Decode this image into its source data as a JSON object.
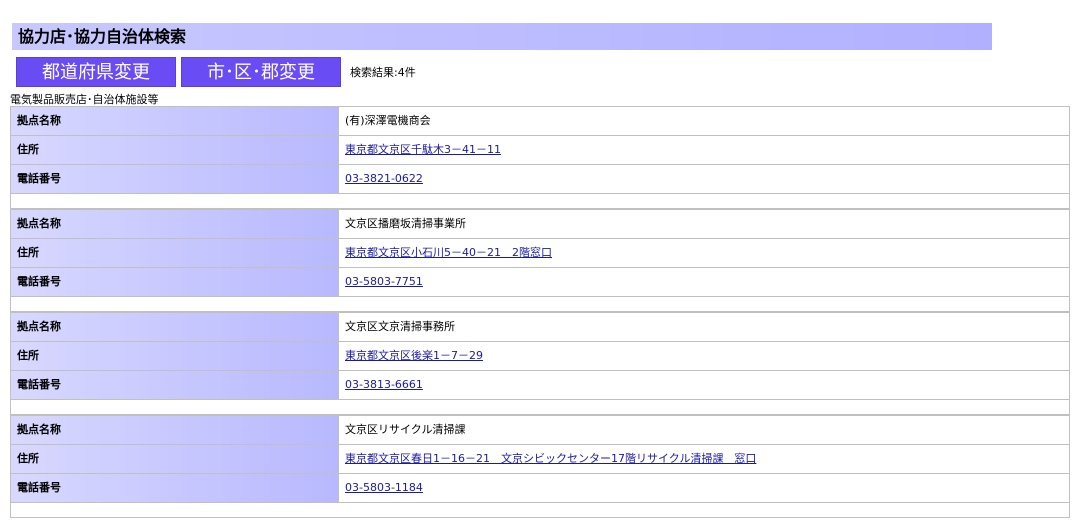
{
  "header": {
    "title": "協力店･協力自治体検索"
  },
  "buttons": {
    "pref_change": "都道府県変更",
    "city_change": "市･区･郡変更"
  },
  "result_count": "検索結果:4件",
  "category": "電気製品販売店･自治体施設等",
  "labels": {
    "name": "拠点名称",
    "address": "住所",
    "phone": "電話番号"
  },
  "locations": [
    {
      "name": "(有)深澤電機商会",
      "address": "東京都文京区千駄木3－41－11",
      "phone": "03-3821-0622"
    },
    {
      "name": "文京区播磨坂清掃事業所",
      "address": "東京都文京区小石川5－40－21　2階窓口",
      "phone": "03-5803-7751"
    },
    {
      "name": "文京区文京清掃事務所",
      "address": "東京都文京区後楽1－7－29",
      "phone": "03-3813-6661"
    },
    {
      "name": "文京区リサイクル清掃課",
      "address": "東京都文京区春日1－16－21　文京シビックセンター17階リサイクル清掃課　窓口",
      "phone": "03-5803-1184"
    }
  ]
}
